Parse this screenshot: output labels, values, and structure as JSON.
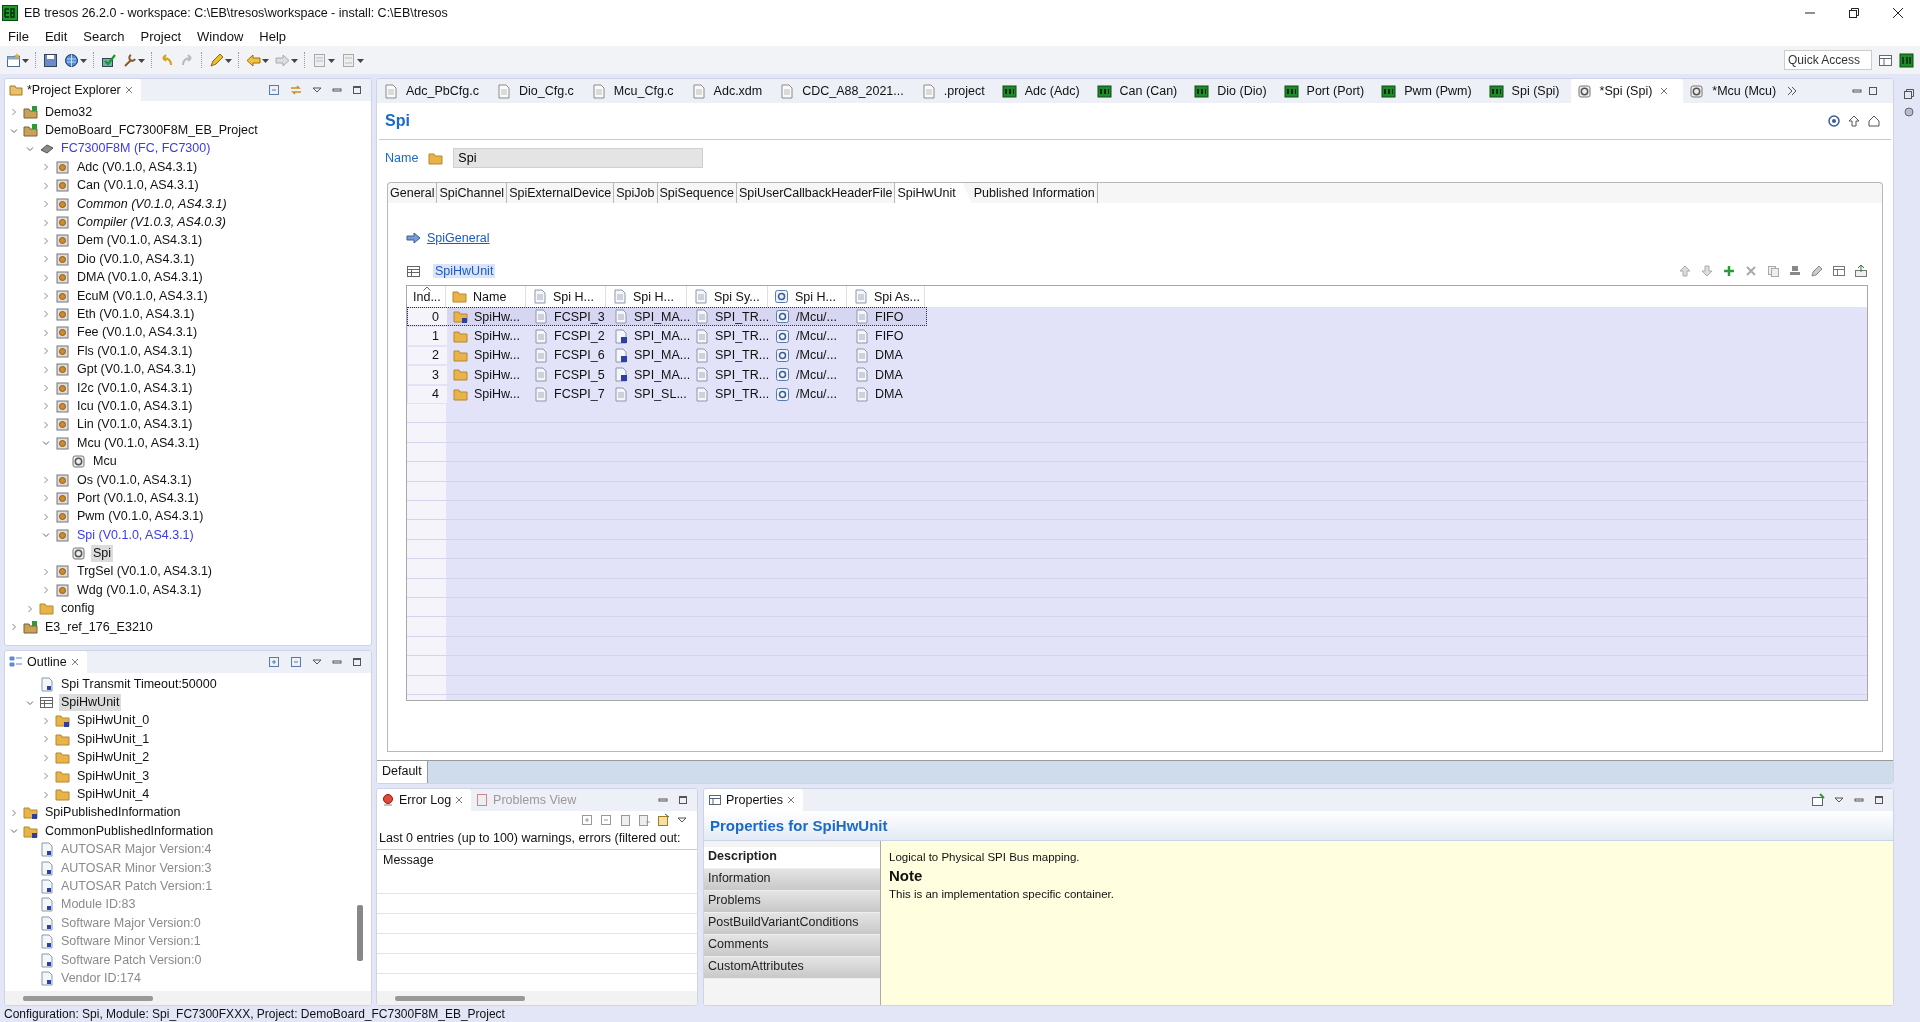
{
  "window": {
    "title": "EB tresos 26.2.0 - workspace: C:\\EB\\tresos\\workspace - install: C:\\EB\\tresos"
  },
  "menu": [
    "File",
    "Edit",
    "Search",
    "Project",
    "Window",
    "Help"
  ],
  "quick_access": {
    "placeholder": "Quick Access"
  },
  "project_explorer": {
    "title": "*Project Explorer",
    "items": [
      {
        "label": "Demo32",
        "kind": "project",
        "expanded": false
      },
      {
        "label": "DemoBoard_FC7300F8M_EB_Project",
        "kind": "project",
        "expanded": true,
        "children": [
          {
            "label": "FC7300F8M (FC, FC7300)",
            "kind": "chip",
            "expanded": true,
            "active": true,
            "children": [
              {
                "label": "Adc (V0.1.0, AS4.3.1)",
                "kind": "module",
                "expanded": false,
                "active": false,
                "enabled": true
              },
              {
                "label": "Can (V0.1.0, AS4.3.1)",
                "kind": "module",
                "expanded": false,
                "active": false,
                "enabled": true
              },
              {
                "label": "Common (V0.1.0, AS4.3.1)",
                "kind": "module",
                "expanded": false,
                "active": false,
                "enabled": false
              },
              {
                "label": "Compiler (V1.0.3, AS4.0.3)",
                "kind": "module",
                "expanded": false,
                "active": false,
                "enabled": false
              },
              {
                "label": "Dem (V0.1.0, AS4.3.1)",
                "kind": "module",
                "expanded": false,
                "active": false,
                "enabled": true
              },
              {
                "label": "Dio (V0.1.0, AS4.3.1)",
                "kind": "module",
                "expanded": false,
                "active": false,
                "enabled": true
              },
              {
                "label": "DMA (V0.1.0, AS4.3.1)",
                "kind": "module",
                "expanded": false,
                "active": false,
                "enabled": true
              },
              {
                "label": "EcuM (V0.1.0, AS4.3.1)",
                "kind": "module",
                "expanded": false,
                "active": false,
                "enabled": true
              },
              {
                "label": "Eth (V0.1.0, AS4.3.1)",
                "kind": "module",
                "expanded": false,
                "active": false,
                "enabled": true
              },
              {
                "label": "Fee (V0.1.0, AS4.3.1)",
                "kind": "module",
                "expanded": false,
                "active": false,
                "enabled": true
              },
              {
                "label": "Fls (V0.1.0, AS4.3.1)",
                "kind": "module",
                "expanded": false,
                "active": false,
                "enabled": true
              },
              {
                "label": "Gpt (V0.1.0, AS4.3.1)",
                "kind": "module",
                "expanded": false,
                "active": false,
                "enabled": true
              },
              {
                "label": "I2c (V0.1.0, AS4.3.1)",
                "kind": "module",
                "expanded": false,
                "active": false,
                "enabled": true
              },
              {
                "label": "Icu (V0.1.0, AS4.3.1)",
                "kind": "module",
                "expanded": false,
                "active": false,
                "enabled": true
              },
              {
                "label": "Lin (V0.1.0, AS4.3.1)",
                "kind": "module",
                "expanded": false,
                "active": false,
                "enabled": true
              },
              {
                "label": "Mcu (V0.1.0, AS4.3.1)",
                "kind": "module",
                "expanded": true,
                "active": false,
                "enabled": true,
                "children": [
                  {
                    "label": "Mcu",
                    "kind": "config",
                    "selected": false
                  }
                ]
              },
              {
                "label": "Os (V0.1.0, AS4.3.1)",
                "kind": "module",
                "expanded": false,
                "active": false,
                "enabled": true
              },
              {
                "label": "Port (V0.1.0, AS4.3.1)",
                "kind": "module",
                "expanded": false,
                "active": false,
                "enabled": true
              },
              {
                "label": "Pwm (V0.1.0, AS4.3.1)",
                "kind": "module",
                "expanded": false,
                "active": false,
                "enabled": true
              },
              {
                "label": "Spi (V0.1.0, AS4.3.1)",
                "kind": "module",
                "expanded": true,
                "active": true,
                "enabled": true,
                "children": [
                  {
                    "label": "Spi",
                    "kind": "config",
                    "selected": true
                  }
                ]
              },
              {
                "label": "TrgSel (V0.1.0, AS4.3.1)",
                "kind": "module",
                "expanded": false,
                "active": false,
                "enabled": true
              },
              {
                "label": "Wdg (V0.1.0, AS4.3.1)",
                "kind": "module",
                "expanded": false,
                "active": false,
                "enabled": true
              }
            ]
          },
          {
            "label": "config",
            "kind": "folder",
            "expanded": false
          }
        ]
      },
      {
        "label": "E3_ref_176_E3210",
        "kind": "project",
        "expanded": false
      }
    ]
  },
  "outline": {
    "title": "Outline",
    "items": [
      {
        "children": [
          {
            "label": "Spi Transmit Timeout:50000",
            "kind": "parameter",
            "disabled": false
          },
          {
            "label": "SpiHwUnit",
            "kind": "table",
            "expanded": true,
            "selected": true,
            "disabled": false,
            "children": [
              {
                "label": "SpiHwUnit_0",
                "kind": "reference-folder",
                "expanded": false,
                "disabled": false
              },
              {
                "label": "SpiHwUnit_1",
                "kind": "folder",
                "expanded": false,
                "disabled": false
              },
              {
                "label": "SpiHwUnit_2",
                "kind": "folder",
                "expanded": false,
                "disabled": false
              },
              {
                "label": "SpiHwUnit_3",
                "kind": "folder",
                "expanded": false,
                "disabled": false
              },
              {
                "label": "SpiHwUnit_4",
                "kind": "folder",
                "expanded": false,
                "disabled": false
              }
            ]
          }
        ]
      },
      {
        "label": "SpiPublishedInformation",
        "kind": "reference-folder",
        "expanded": false,
        "disabled": false
      },
      {
        "label": "CommonPublishedInformation",
        "kind": "reference-folder",
        "expanded": true,
        "disabled": false,
        "children": [
          {
            "label": "AUTOSAR Major Version:4",
            "kind": "parameter",
            "disabled": true
          },
          {
            "label": "AUTOSAR Minor Version:3",
            "kind": "parameter",
            "disabled": true
          },
          {
            "label": "AUTOSAR Patch Version:1",
            "kind": "parameter",
            "disabled": true
          },
          {
            "label": "Module ID:83",
            "kind": "parameter",
            "disabled": true
          },
          {
            "label": "Software Major Version:0",
            "kind": "parameter",
            "disabled": true
          },
          {
            "label": "Software Minor Version:1",
            "kind": "parameter",
            "disabled": true
          },
          {
            "label": "Software Patch Version:0",
            "kind": "parameter",
            "disabled": true
          },
          {
            "label": "Vendor ID:174",
            "kind": "parameter",
            "disabled": true
          }
        ]
      }
    ]
  },
  "editor_tabs": [
    {
      "label": "Adc_PbCfg.c",
      "kind": "file",
      "selected": false
    },
    {
      "label": "Dio_Cfg.c",
      "kind": "file",
      "selected": false
    },
    {
      "label": "Mcu_Cfg.c",
      "kind": "file",
      "selected": false
    },
    {
      "label": "Adc.xdm",
      "kind": "file",
      "selected": false
    },
    {
      "label": "CDC_A88_2021...",
      "kind": "file",
      "selected": false
    },
    {
      "label": ".project",
      "kind": "file",
      "selected": false
    },
    {
      "label": "Adc (Adc)",
      "kind": "module",
      "selected": false
    },
    {
      "label": "Can (Can)",
      "kind": "module",
      "selected": false
    },
    {
      "label": "Dio (Dio)",
      "kind": "module",
      "selected": false
    },
    {
      "label": "Port (Port)",
      "kind": "module",
      "selected": false
    },
    {
      "label": "Pwm (Pwm)",
      "kind": "module",
      "selected": false
    },
    {
      "label": "Spi (Spi)",
      "kind": "module",
      "selected": false
    },
    {
      "label": "*Spi (Spi)",
      "kind": "config",
      "selected": true
    },
    {
      "label": "*Mcu (Mcu)",
      "kind": "config",
      "selected": false
    }
  ],
  "editor": {
    "title": "Spi",
    "name_label": "Name",
    "name_value": "Spi",
    "tabs": [
      {
        "label": "General",
        "selected": false
      },
      {
        "label": "SpiChannel",
        "selected": false
      },
      {
        "label": "SpiExternalDevice",
        "selected": false
      },
      {
        "label": "SpiJob",
        "selected": false
      },
      {
        "label": "SpiSequence",
        "selected": false
      },
      {
        "label": "SpiUserCallbackHeaderFile",
        "selected": false
      },
      {
        "label": "SpiHwUnit",
        "selected": true
      },
      {
        "label": "Published Information",
        "selected": false
      }
    ],
    "general_link": "SpiGeneral",
    "table_title": "SpiHwUnit",
    "table": {
      "columns": [
        {
          "label": "Ind...",
          "kind": "index",
          "sorted": true
        },
        {
          "label": "Name",
          "kind": "folder",
          "sorted": false
        },
        {
          "label": "Spi H...",
          "kind": "text",
          "sorted": false
        },
        {
          "label": "Spi H...",
          "kind": "text",
          "sorted": false
        },
        {
          "label": "Spi Sy...",
          "kind": "text",
          "sorted": false
        },
        {
          "label": "Spi H...",
          "kind": "reference",
          "sorted": false
        },
        {
          "label": "Spi As...",
          "kind": "text",
          "sorted": false
        }
      ],
      "rows": [
        {
          "selected": true,
          "cells": [
            {
              "text": "0",
              "kind": "index"
            },
            {
              "text": "SpiHw...",
              "kind": "reference-folder"
            },
            {
              "text": "FCSPI_3",
              "kind": "text"
            },
            {
              "text": "SPI_MA...",
              "kind": "text"
            },
            {
              "text": "SPI_TR...",
              "kind": "text"
            },
            {
              "text": "/Mcu/...",
              "kind": "reference"
            },
            {
              "text": "FIFO",
              "kind": "text"
            }
          ]
        },
        {
          "selected": false,
          "cells": [
            {
              "text": "1",
              "kind": "index"
            },
            {
              "text": "SpiHw...",
              "kind": "folder"
            },
            {
              "text": "FCSPI_2",
              "kind": "text"
            },
            {
              "text": "SPI_MA...",
              "kind": "default"
            },
            {
              "text": "SPI_TR...",
              "kind": "text"
            },
            {
              "text": "/Mcu/...",
              "kind": "reference"
            },
            {
              "text": "FIFO",
              "kind": "text"
            }
          ]
        },
        {
          "selected": false,
          "cells": [
            {
              "text": "2",
              "kind": "index"
            },
            {
              "text": "SpiHw...",
              "kind": "folder"
            },
            {
              "text": "FCSPI_6",
              "kind": "text"
            },
            {
              "text": "SPI_MA...",
              "kind": "default"
            },
            {
              "text": "SPI_TR...",
              "kind": "text"
            },
            {
              "text": "/Mcu/...",
              "kind": "reference"
            },
            {
              "text": "DMA",
              "kind": "text"
            }
          ]
        },
        {
          "selected": false,
          "cells": [
            {
              "text": "3",
              "kind": "index"
            },
            {
              "text": "SpiHw...",
              "kind": "folder"
            },
            {
              "text": "FCSPI_5",
              "kind": "text"
            },
            {
              "text": "SPI_MA...",
              "kind": "default"
            },
            {
              "text": "SPI_TR...",
              "kind": "text"
            },
            {
              "text": "/Mcu/...",
              "kind": "reference"
            },
            {
              "text": "DMA",
              "kind": "text"
            }
          ]
        },
        {
          "selected": false,
          "cells": [
            {
              "text": "4",
              "kind": "index"
            },
            {
              "text": "SpiHw...",
              "kind": "folder"
            },
            {
              "text": "FCSPI_7",
              "kind": "text"
            },
            {
              "text": "SPI_SL...",
              "kind": "text"
            },
            {
              "text": "SPI_TR...",
              "kind": "text"
            },
            {
              "text": "/Mcu/...",
              "kind": "reference"
            },
            {
              "text": "DMA",
              "kind": "text"
            }
          ]
        }
      ]
    },
    "footer_tab": "Default"
  },
  "error_log": {
    "tabs": [
      {
        "label": "Error Log",
        "selected": true
      },
      {
        "label": "Problems View",
        "selected": false
      }
    ],
    "summary": "Last 0 entries (up to 100) warnings, errors (filtered out:",
    "column": "Message"
  },
  "properties": {
    "tab": "Properties",
    "title": "Properties for SpiHwUnit",
    "sections": [
      {
        "label": "Description",
        "selected": true
      },
      {
        "label": "Information",
        "selected": false
      },
      {
        "label": "Problems",
        "selected": false
      },
      {
        "label": "PostBuildVariantConditions",
        "selected": false
      },
      {
        "label": "Comments",
        "selected": false
      },
      {
        "label": "CustomAttributes",
        "selected": false
      }
    ],
    "description": "Logical to Physical SPI Bus mapping.",
    "note_heading": "Note",
    "note": "This is an implementation specific container."
  },
  "status_bar": "Configuration: Spi, Module: Spi_FC7300FXXX, Project: DemoBoard_FC7300F8M_EB_Project"
}
